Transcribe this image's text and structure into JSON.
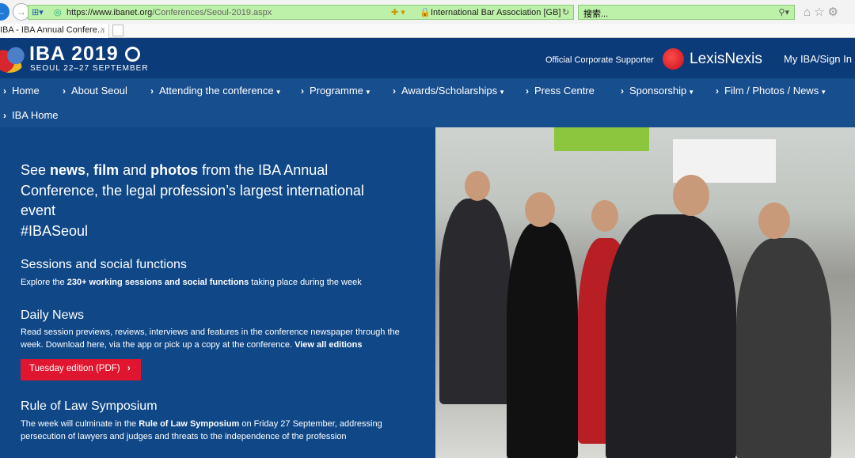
{
  "browser": {
    "url_host": "https://www.ibanet.org",
    "url_path": "/Conferences/Seoul-2019.aspx",
    "site_identity": "International Bar Association [GB]",
    "search_placeholder": "搜索...",
    "tab_title": "IBA - IBA Annual Confere...",
    "tab_close": "×"
  },
  "header": {
    "logo_title": "IBA 2019",
    "logo_subtitle": "SEOUL 22–27 SEPTEMBER",
    "supporter_label": "Official Corporate Supporter",
    "supporter_name": "LexisNexis",
    "signin": "My IBA/Sign In"
  },
  "nav": {
    "items": [
      {
        "label": "Home",
        "dropdown": false
      },
      {
        "label": "About Seoul",
        "dropdown": false
      },
      {
        "label": "Attending the conference",
        "dropdown": true
      },
      {
        "label": "Programme",
        "dropdown": true
      },
      {
        "label": "Awards/Scholarships",
        "dropdown": true
      },
      {
        "label": "Press Centre",
        "dropdown": false
      },
      {
        "label": "Sponsorship",
        "dropdown": true
      },
      {
        "label": "Film / Photos / News",
        "dropdown": true
      },
      {
        "label": "IBA Home",
        "dropdown": false
      }
    ]
  },
  "main": {
    "intro": {
      "a": "See ",
      "b": "news",
      "c": ", ",
      "d": "film",
      "e": " and ",
      "f": "photos",
      "g": " from the IBA Annual Conference, the legal profession’s largest international event",
      "hashtag": "#IBASeoul"
    },
    "sessions": {
      "title": "Sessions and social functions",
      "t1": "Explore the ",
      "bold": "230+ working sessions and social functions",
      "t2": " taking place during the week"
    },
    "daily": {
      "title": "Daily News",
      "text": "Read session previews, reviews, interviews and features in the conference newspaper through the week. Download here, via the app or pick up a copy at the conference. ",
      "link": "View all editions",
      "button": "Tuesday edition (PDF)"
    },
    "rule": {
      "title": "Rule of Law Symposium",
      "t1": "The week will culminate in the ",
      "bold": "Rule of Law Symposium",
      "t2": " on Friday 27 September, addressing persecution of lawyers and judges and threats to the independence of the profession"
    }
  }
}
